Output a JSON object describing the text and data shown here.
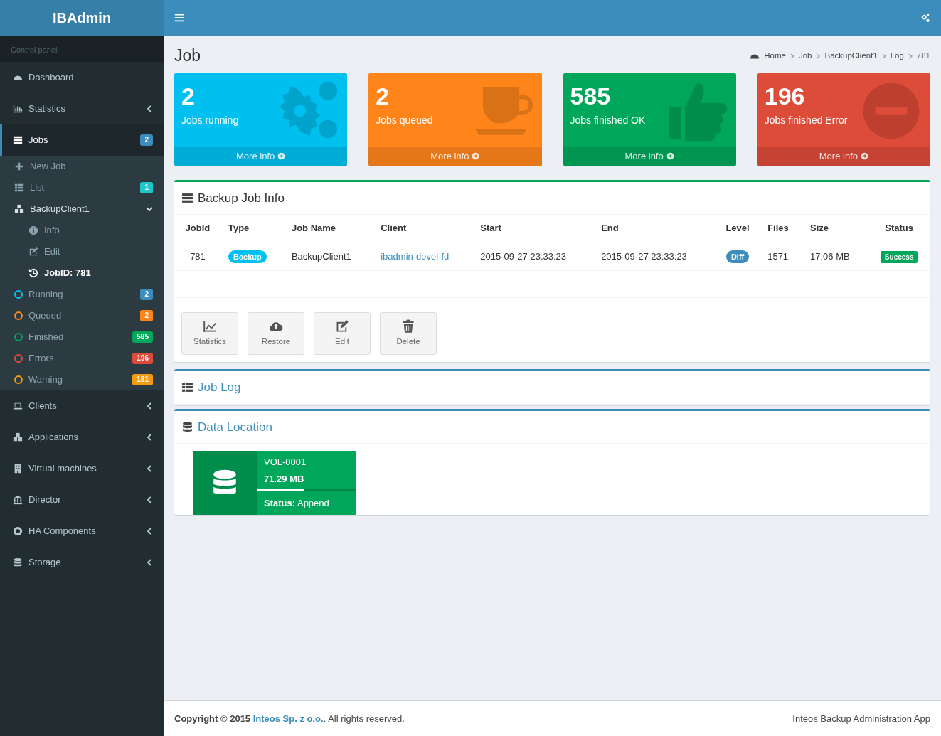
{
  "header": {
    "logo": "IBAdmin"
  },
  "sidebar": {
    "heading": "Control panel",
    "items": [
      {
        "label": "Dashboard",
        "selected": false
      },
      {
        "label": "Statistics",
        "selected": false,
        "expanded": false
      },
      {
        "label": "Jobs",
        "selected": true,
        "badge": {
          "text": "2",
          "color": "#3c8dbc"
        },
        "children": [
          {
            "kind": "link",
            "label": "New Job",
            "selected": false
          },
          {
            "kind": "link",
            "label": "List",
            "selected": false,
            "badge": {
              "text": "1",
              "color": "#1fc7c9"
            }
          },
          {
            "kind": "link",
            "label": "BackupClient1",
            "selected": false,
            "expanded": true,
            "children": [
              {
                "label": "Info",
                "selected": false
              },
              {
                "label": "Edit",
                "selected": false
              },
              {
                "label": "JobID: 781",
                "selected": true
              }
            ]
          },
          {
            "kind": "status",
            "label": "Running",
            "selected": false,
            "color": "#00c0ef",
            "badge": {
              "text": "2",
              "color": "#3c8dbc"
            }
          },
          {
            "kind": "status",
            "label": "Queued",
            "selected": false,
            "color": "#ff851b",
            "badge": {
              "text": "2",
              "color": "#ff851b"
            }
          },
          {
            "kind": "status",
            "label": "Finished",
            "selected": false,
            "color": "#00a65a",
            "badge": {
              "text": "585",
              "color": "#00a65a"
            }
          },
          {
            "kind": "status",
            "label": "Errors",
            "selected": false,
            "color": "#dd4b39",
            "badge": {
              "text": "196",
              "color": "#dd4b39"
            }
          },
          {
            "kind": "status",
            "label": "Warning",
            "selected": false,
            "color": "#f39c12",
            "badge": {
              "text": "181",
              "color": "#f39c12"
            }
          }
        ]
      },
      {
        "label": "Clients",
        "selected": false,
        "expanded": false
      },
      {
        "label": "Applications",
        "selected": false,
        "expanded": false
      },
      {
        "label": "Virtual machines",
        "selected": false,
        "expanded": false
      },
      {
        "label": "Director",
        "selected": false,
        "expanded": false
      },
      {
        "label": "HA Components",
        "selected": false,
        "expanded": false
      },
      {
        "label": "Storage",
        "selected": false,
        "expanded": false
      }
    ]
  },
  "page": {
    "title": "Job",
    "breadcrumb": [
      "Home",
      "Job",
      "BackupClient1",
      "Log",
      "781"
    ]
  },
  "stat_boxes": [
    {
      "number": "2",
      "label": "Jobs running",
      "link": "More info",
      "color": "#00c0ef"
    },
    {
      "number": "2",
      "label": "Jobs queued",
      "link": "More info",
      "color": "#ff851b"
    },
    {
      "number": "585",
      "label": "Jobs finished OK",
      "link": "More info",
      "color": "#00a65a"
    },
    {
      "number": "196",
      "label": "Jobs finished Error",
      "link": "More info",
      "color": "#dd4b39"
    }
  ],
  "job_info": {
    "title": "Backup Job Info",
    "columns": [
      "JobId",
      "Type",
      "Job Name",
      "Client",
      "Start",
      "End",
      "Level",
      "Files",
      "Size",
      "Status"
    ],
    "rows": [
      [
        {
          "kind": "text",
          "text": "781"
        },
        {
          "kind": "pill",
          "text": "Backup",
          "color": "#00c0ef"
        },
        {
          "kind": "text",
          "text": "BackupClient1"
        },
        {
          "kind": "link",
          "text": "ibadmin-devel-fd"
        },
        {
          "kind": "text",
          "text": "2015-09-27 23:33:23"
        },
        {
          "kind": "text",
          "text": "2015-09-27 23:33:23"
        },
        {
          "kind": "pill",
          "text": "Diff",
          "color": "#3c8dbc"
        },
        {
          "kind": "text",
          "text": "1571"
        },
        {
          "kind": "text",
          "text": "17.06 MB"
        },
        {
          "kind": "label",
          "text": "Success",
          "color": "#00a65a"
        }
      ]
    ],
    "buttons": [
      "Statistics",
      "Restore",
      "Edit",
      "Delete"
    ]
  },
  "job_log": {
    "title": "Job Log"
  },
  "data_location": {
    "title": "Data Location",
    "volumes": [
      {
        "name": "VOL-0001",
        "size": "71.29 MB",
        "level": 0.47,
        "status": "**Status:** Append"
      }
    ]
  },
  "footer": {
    "prefix": "Copyright © 2015",
    "link": "Inteos Sp. z o.o.",
    "suffix": ". All rights reserved.",
    "app_name": "Inteos Backup Administration App"
  }
}
